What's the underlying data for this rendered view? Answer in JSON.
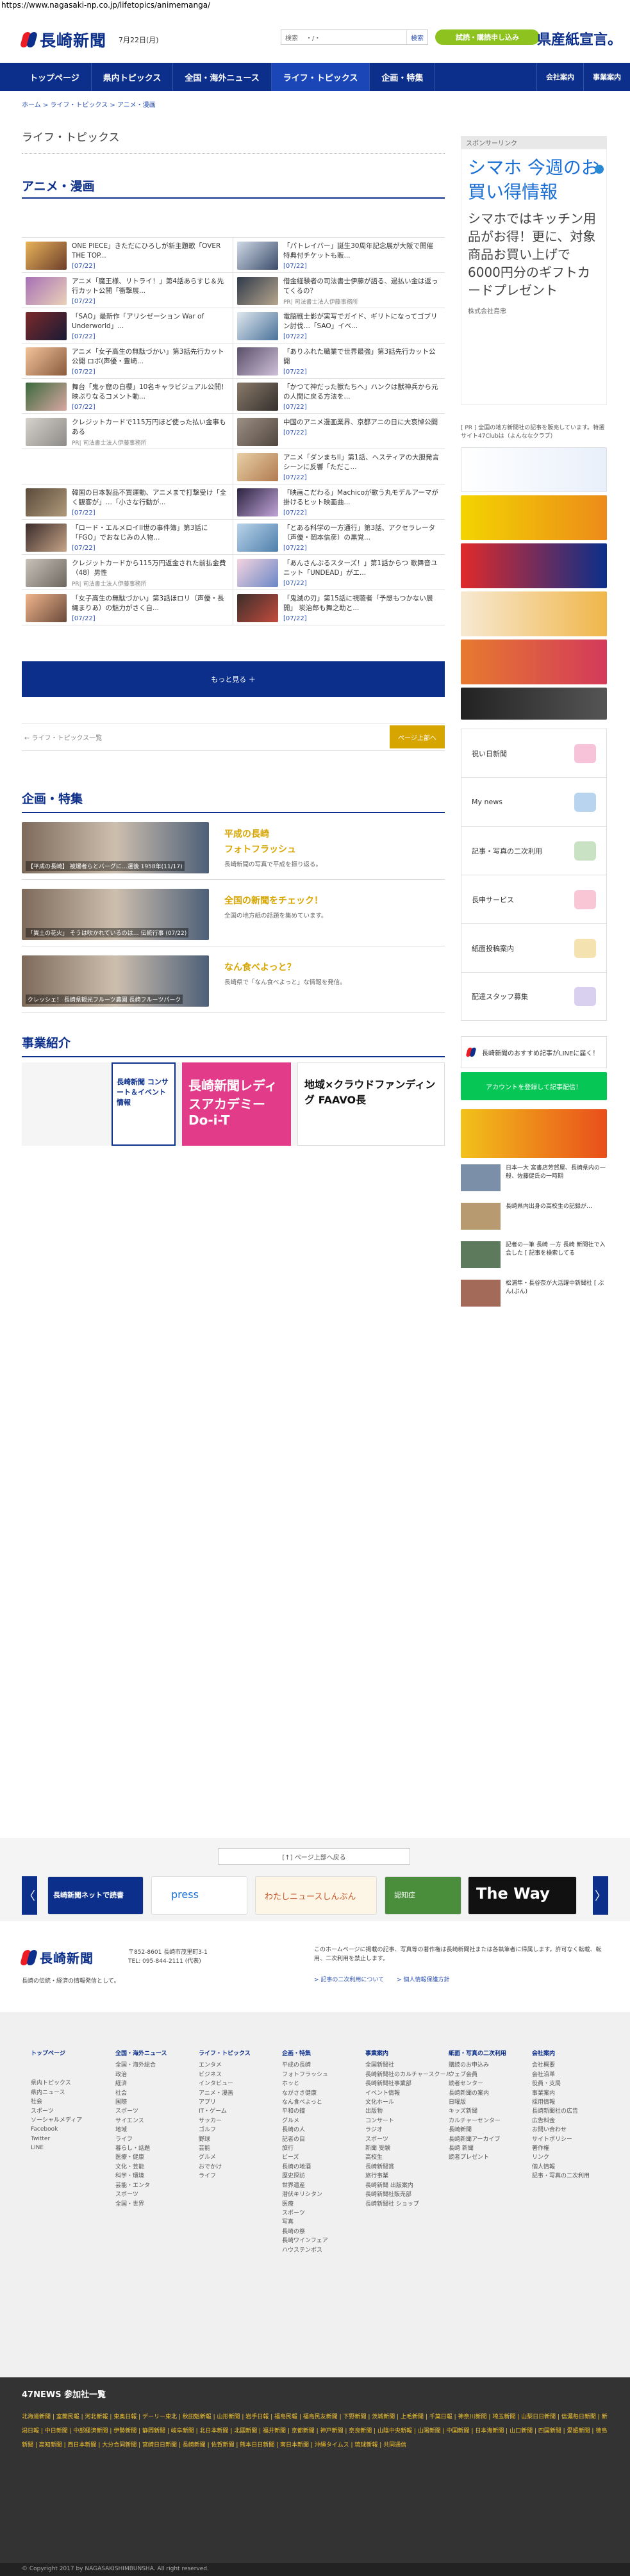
{
  "url": "https://www.nagasaki-np.co.jp/lifetopics/animemanga/",
  "header": {
    "logo": "長崎新聞",
    "date": "7月22日(月)",
    "search_label": "検索",
    "search_sep": "・/・",
    "search_button": "検索",
    "trial": "試読・購読申し込み",
    "promo": "県産紙宣言。"
  },
  "nav": {
    "items": [
      "トップページ",
      "県内トピックス",
      "全国・海外ニュース",
      "ライフ・トピックス",
      "企画・特集"
    ],
    "right": [
      "会社案内",
      "事業案内"
    ]
  },
  "breadcrumb": "ホーム > ライフ・トピックス > アニメ・漫画",
  "page_title": "ライフ・トピックス",
  "section_label": "アニメ・漫画",
  "articles": [
    {
      "title": "ONE PIECE」きただにひろしが新主題歌「OVER THE TOP...",
      "date": "[07/22]",
      "c1": "#e7b35a",
      "c2": "#6d3e2a"
    },
    {
      "title": "「パトレイバー」誕生30周年記念展が大阪で開催 特典付チケットも販...",
      "date": "[07/22]",
      "c1": "#cfd9e6",
      "c2": "#3b4c6b"
    },
    {
      "title": "アニメ「魔王様、リトライ！」第4話あらすじ＆先行カット公開「衝撃展...",
      "date": "[07/22]",
      "c1": "#a86fb6",
      "c2": "#e9d2b8"
    },
    {
      "title": "借金経験者の司法書士伊藤が語る、過払い金は返ってくるの？",
      "date": "",
      "pr": "PR| 司法書士法人伊藤事務所",
      "c1": "#2f3a4a",
      "c2": "#b7a68d"
    },
    {
      "title": "「SAO」最新作「アリシゼーション War of Underworld」...",
      "date": "[07/22]",
      "c1": "#7a2a2a",
      "c2": "#1a1a35"
    },
    {
      "title": "電脳戦士影が実写でガイド、ギリトになってゴブリン討伐…「SAO」イベ...",
      "date": "[07/22]",
      "c1": "#dfe7ee",
      "c2": "#49729a"
    },
    {
      "title": "アニメ「女子高生の無駄づかい」第3話先行カット公開 ロボ(声優・豊崎...",
      "date": "[07/22]",
      "c1": "#f2c39a",
      "c2": "#8a5b3c"
    },
    {
      "title": "「ありふれた職業で世界最強」第3話先行カット公開",
      "date": "[07/22]",
      "c1": "#5a4f6a",
      "c2": "#cfc0d8"
    },
    {
      "title": "舞台「鬼ヶ窟の白櫻」10名キャラビジュアル公開！映ぷりなるコメント動...",
      "date": "[07/22]",
      "c1": "#3b6a3d",
      "c2": "#d9a7a2"
    },
    {
      "title": "「かつて神だった獣たちへ」ハンクは獣神兵から元の人間に戻る方法を...",
      "date": "[07/22]",
      "c1": "#8a7a6a",
      "c2": "#34302c"
    },
    {
      "title": "クレジットカードで115万円ほど使った払い金事もある",
      "date": "",
      "pr": "PR| 司法書士法人伊藤事務所",
      "c1": "#d6d2cc",
      "c2": "#8d8b88"
    },
    {
      "title": "中国のアニメ漫画業界、京都アニの日に大哀悼公開",
      "date": "[07/22]",
      "c1": "#9c8f84",
      "c2": "#51463f"
    },
    {
      "title": "",
      "date": "",
      "c1": "#ffffff",
      "c2": "#ffffff",
      "empty": true
    },
    {
      "title": "アニメ「ダンまちII」第1話、ヘスティアの大胆発言シーンに反響「ただこ...",
      "date": "[07/22]",
      "c1": "#e9d0a6",
      "c2": "#b17a50"
    },
    {
      "title": "韓国の日本製品不買運動、アニメまで打撃受け「全く観客が」…「小さな行動が...",
      "date": "[07/22]",
      "c1": "#5a4a3a",
      "c2": "#b09a7b"
    },
    {
      "title": "「映画こだわる」Machicoが歌う丸モデルアーマが掛けるヒット映画曲...",
      "date": "[07/22]",
      "c1": "#2c2340",
      "c2": "#c2a5d9"
    },
    {
      "title": "「ロード・エルメロイII世の事件簿」第3話に「FGO」でおなじみの人物...",
      "date": "[07/22]",
      "c1": "#3a2b2b",
      "c2": "#c6a487"
    },
    {
      "title": "「とある科学の一方通行」第3話、アクセラレータ（声優・岡本信彦）の黒覚...",
      "date": "[07/22]",
      "c1": "#b9d3ea",
      "c2": "#4e7fab"
    },
    {
      "title": "クレジットカードから115万円返金された前払金費（48）男性",
      "date": "",
      "pr": "PR| 司法書士法人伊藤事務所",
      "c1": "#c7c2ba",
      "c2": "#6d6760"
    },
    {
      "title": "「あんさんぶるスターズ！」第1話からつ 歌舞音ユニット「UNDEAD」がエ...",
      "date": "[07/22]",
      "c1": "#f5d3e0",
      "c2": "#6a88c6"
    },
    {
      "title": "「女子高生の無駄づかい」第3話ほロリ（声優・長縄まりあ）の魅力がさく自...",
      "date": "[07/22]",
      "c1": "#f0b58c",
      "c2": "#6a4a3b"
    },
    {
      "title": "「鬼滅の刃」第15話に視聴者「予想もつかない展開」 炭治郎も舞之助と...",
      "date": "[07/22]",
      "c1": "#3b2f2a",
      "c2": "#c34b3e"
    }
  ],
  "more": "もっと見る ＋",
  "back": "← ライフ・トピックス一覧",
  "pagetop": "ページ上部へ",
  "feature_label": "企画・特集",
  "features": [
    {
      "caption": "【平成の長崎】 被爆者らとバーグに…選後 1958年(11/17)",
      "title": "平成の長崎",
      "title2": "フォトフラッシュ",
      "desc": "長崎新聞の写真で平成を振り返る。"
    },
    {
      "caption": "「異土の花火」 そうは吹かれているのは… 伝統行事 (07/22)",
      "title": "全国の新聞をチェック！",
      "desc": "全国の地方紙の話題を集めています。"
    },
    {
      "caption": "クレッシェ！ 長崎県観光フルーツ農園 長崎フルーツパーク",
      "title": "なん食べよっと？",
      "desc": "長崎県で「なん食べよっと」な情報を発信。"
    }
  ],
  "business_label": "事業紹介",
  "business": [
    "長崎新聞 コンサート＆イベント情報",
    "長崎新聞レディスアカデミー Do-i-T",
    "地域×クラウドファンディング FAAVO長"
  ],
  "side": {
    "sponsor": "スポンサーリンク",
    "ad_l1": "シマホ 今週のお買い得情報",
    "ad_l2": "シマホではキッチン用品がお得！更に、対象商品お買い上げで6000円分のギフトカードプレゼント",
    "ad_l3": "株式会社島忠",
    "pr_text": "[ PR ] 全国の地方新聞社の記事を販売しています。特選サイト47Clubは（よんななクラブ）",
    "links": [
      "祝い日新聞",
      "My news",
      "記事・写真の二次利用",
      "長申サービス",
      "紙面投稿案内",
      "配達スタッフ募集"
    ],
    "line_title": "長崎新聞のおすすめ記事がLINEに届く！",
    "line_btn": "アカウントを登録して記事配信！",
    "news": [
      {
        "t": "日本一大 宮書店芳賀屋、長崎県内の一般、佐藤健氏の一時期"
      },
      {
        "t": "長崎県内出身の高校生の記録が…"
      },
      {
        "t": "記者の一筆 長崎 一方 長崎 新聞社で入会した [ 記事を検索してる"
      },
      {
        "t": "松浦隼・長谷奈が大活躍中新聞社 [ ぶん(ぶん)"
      }
    ]
  },
  "carousel": {
    "close": "[↑] ページ上部へ戻る",
    "prev": "〈",
    "next": "〉",
    "banners": [
      "長崎新聞ネットで読書",
      "press",
      "わたしニュースしんぶん",
      "認知症",
      "The Way"
    ]
  },
  "footer": {
    "logo": "長崎新聞",
    "address": "〒852-8601 長崎市茂里町3-1",
    "tel": "TEL: 095-844-2111 (代表)",
    "tagline": "長崎の伝統・経済の情報発信として。",
    "notice": "このホームページに掲載の記事、写真等の著作権は長崎新聞社または各執筆者に帰属します。許可なく転載、転用、二次利用を禁止します。",
    "links2": [
      "> 記事の二次利用について",
      "> 個人情報保護方針"
    ],
    "cols": [
      {
        "hd": "トップページ",
        "items": [
          "",
          "",
          "県内トピックス",
          "県内ニュース",
          "社会",
          "スポーツ",
          "ソーシャルメディア",
          "Facebook",
          "Twitter",
          "LINE"
        ]
      },
      {
        "hd": "全国・海外ニュース",
        "items": [
          "全国・海外総合",
          "政治",
          "経済",
          "社会",
          "国際",
          "スポーツ",
          "サイエンス",
          "地域",
          "ライフ",
          "暮らし・話題",
          "医療・健康",
          "文化・芸能",
          "科学・環境",
          "芸能・エンタ",
          "スポーツ",
          "全国・世界"
        ]
      },
      {
        "hd": "ライフ・トピックス",
        "items": [
          "エンタメ",
          "ビジネス",
          "インタビュー",
          "アニメ・漫画",
          "アプリ",
          "IT・ゲーム",
          "サッカー",
          "ゴルフ",
          "野球",
          "芸能",
          "グルメ",
          "おでかけ",
          "ライフ"
        ]
      },
      {
        "hd": "企画・特集",
        "items": [
          "平成の長崎",
          "フォトフラッシュ",
          "ホッと",
          "ながさき健康",
          "なん食べよっと",
          "平和の鐘",
          "グルメ",
          "長崎の人",
          "記者の目",
          "旅行",
          "ビーズ",
          "長崎の地酒",
          "歴史探訪",
          "世界遺産",
          "潜伏キリシタン",
          "医療",
          "スポーツ",
          "写真",
          "長崎の祭",
          "長崎ワインフェア",
          "ハウステンボス"
        ]
      },
      {
        "hd": "事業案内",
        "items": [
          "全国新聞社",
          "長崎新聞社のカルチャースクール",
          "長崎新聞社事業部",
          "イベント情報",
          "文化ホール",
          "出版物",
          "コンサート",
          "ラジオ",
          "スポーツ",
          "新聞 受験",
          "高校生",
          "長崎新聞賞",
          "旅行事業",
          "長崎新聞 出版案内",
          "長崎新聞社販売部",
          "長崎新聞社 ショップ"
        ]
      },
      {
        "hd": "紙面・写真の二次利用",
        "items": [
          "購読のお申込み",
          "ウェブ会員",
          "読者センター",
          "長崎新聞の案内",
          "日曜版",
          "キッズ新聞",
          "カルチャーセンター",
          "長崎新聞",
          "長崎新聞アーカイブ",
          "長崎 新聞",
          "読者プレゼント"
        ]
      },
      {
        "hd": "会社案内",
        "items": [
          "会社概要",
          "会社沿革",
          "役員・支局",
          "事業案内",
          "採用情報",
          "長崎新聞社の広告",
          "広告料金",
          "お問い合わせ",
          "サイトポリシー",
          "著作権",
          "リンク",
          "個人情報",
          "記事・写真の二次利用"
        ]
      }
    ]
  },
  "news47": {
    "title": "47NEWS 参加社一覧",
    "links": "北海道新聞 | 室蘭民報 | 河北新報 | 東奥日報 | デーリー東北 | 秋田魁新報 | 山形新聞 | 岩手日報 | 福島民報 | 福島民友新聞 | 下野新聞 | 茨城新聞 | 上毛新聞 | 千葉日報 | 神奈川新聞 | 埼玉新聞 | 山梨日日新聞 | 信濃毎日新聞 | 新潟日報 | 中日新聞 | 中部経済新聞 | 伊勢新聞 | 静岡新聞 | 岐阜新聞 | 北日本新聞 | 北國新聞 | 福井新聞 | 京都新聞 | 神戸新聞 | 奈良新聞 | 山陰中央新報 | 山陽新聞 | 中国新聞 | 日本海新聞 | 山口新聞 | 四国新聞 | 愛媛新聞 | 徳島新聞 | 高知新聞 | 西日本新聞 | 大分合同新聞 | 宮崎日日新聞 | 長崎新聞 | 佐賀新聞 | 熊本日日新聞 | 南日本新聞 | 沖縄タイムス | 琉球新報 | 共同通信"
  },
  "copyright": "© Copyright 2017 by NAGASAKISHIMBUNSHA. All right reserved."
}
